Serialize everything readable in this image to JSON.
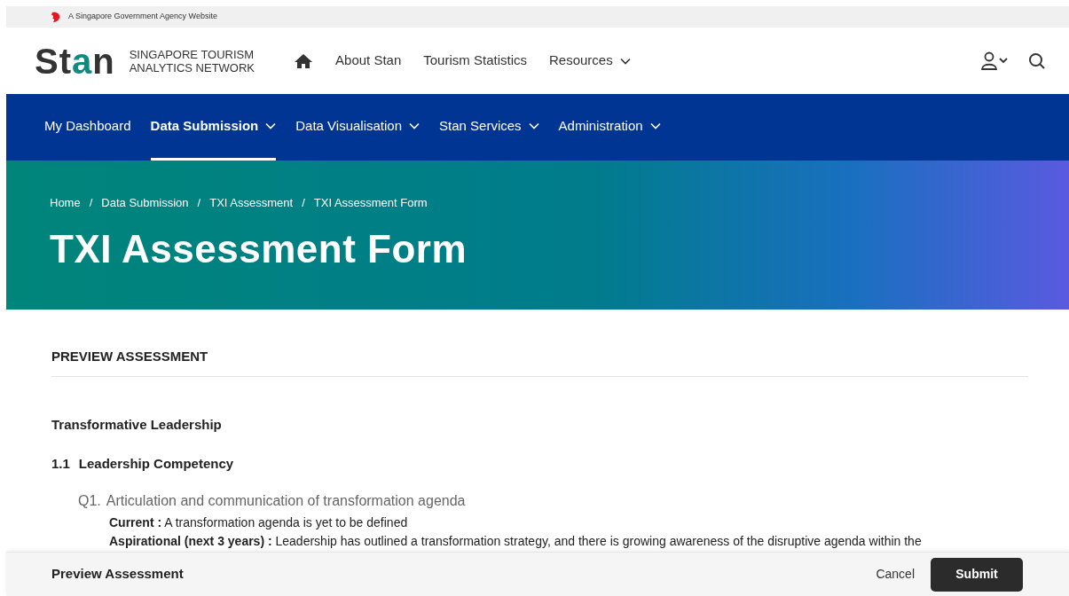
{
  "gov_bar": {
    "text": "A Singapore Government Agency Website"
  },
  "header": {
    "logo": "Stan",
    "tagline": [
      "SINGAPORE TOURISM",
      "ANALYTICS NETWORK"
    ],
    "nav": [
      {
        "label": "About Stan",
        "has_menu": false
      },
      {
        "label": "Tourism Statistics",
        "has_menu": false
      },
      {
        "label": "Resources",
        "has_menu": true
      }
    ]
  },
  "main_nav": [
    {
      "label": "My Dashboard",
      "has_menu": false,
      "selected": false
    },
    {
      "label": "Data Submission",
      "has_menu": true,
      "selected": true
    },
    {
      "label": "Data Visualisation",
      "has_menu": true,
      "selected": false
    },
    {
      "label": "Stan Services",
      "has_menu": true,
      "selected": false
    },
    {
      "label": "Administration",
      "has_menu": true,
      "selected": false
    }
  ],
  "breadcrumbs": [
    "Home",
    "Data Submission",
    "TXI Assessment",
    "TXI Assessment Form"
  ],
  "breadcrumb_separator": "/",
  "page_title": "TXI Assessment Form",
  "section_heading": "PREVIEW ASSESSMENT",
  "pillar": "Transformative Leadership",
  "subsection": {
    "number": "1.1",
    "title": "Leadership Competency"
  },
  "question": {
    "number": "Q1.",
    "text": "Articulation and communication of transformation agenda",
    "answers": [
      {
        "label": "Current :",
        "text": "A transformation agenda is yet to be defined"
      },
      {
        "label": "Aspirational  (next 3 years) :",
        "text": "Leadership has outlined a transformation strategy, and there is growing awareness of the disruptive agenda within the"
      }
    ]
  },
  "footer": {
    "title": "Preview Assessment",
    "cancel": "Cancel",
    "submit": "Submit"
  }
}
